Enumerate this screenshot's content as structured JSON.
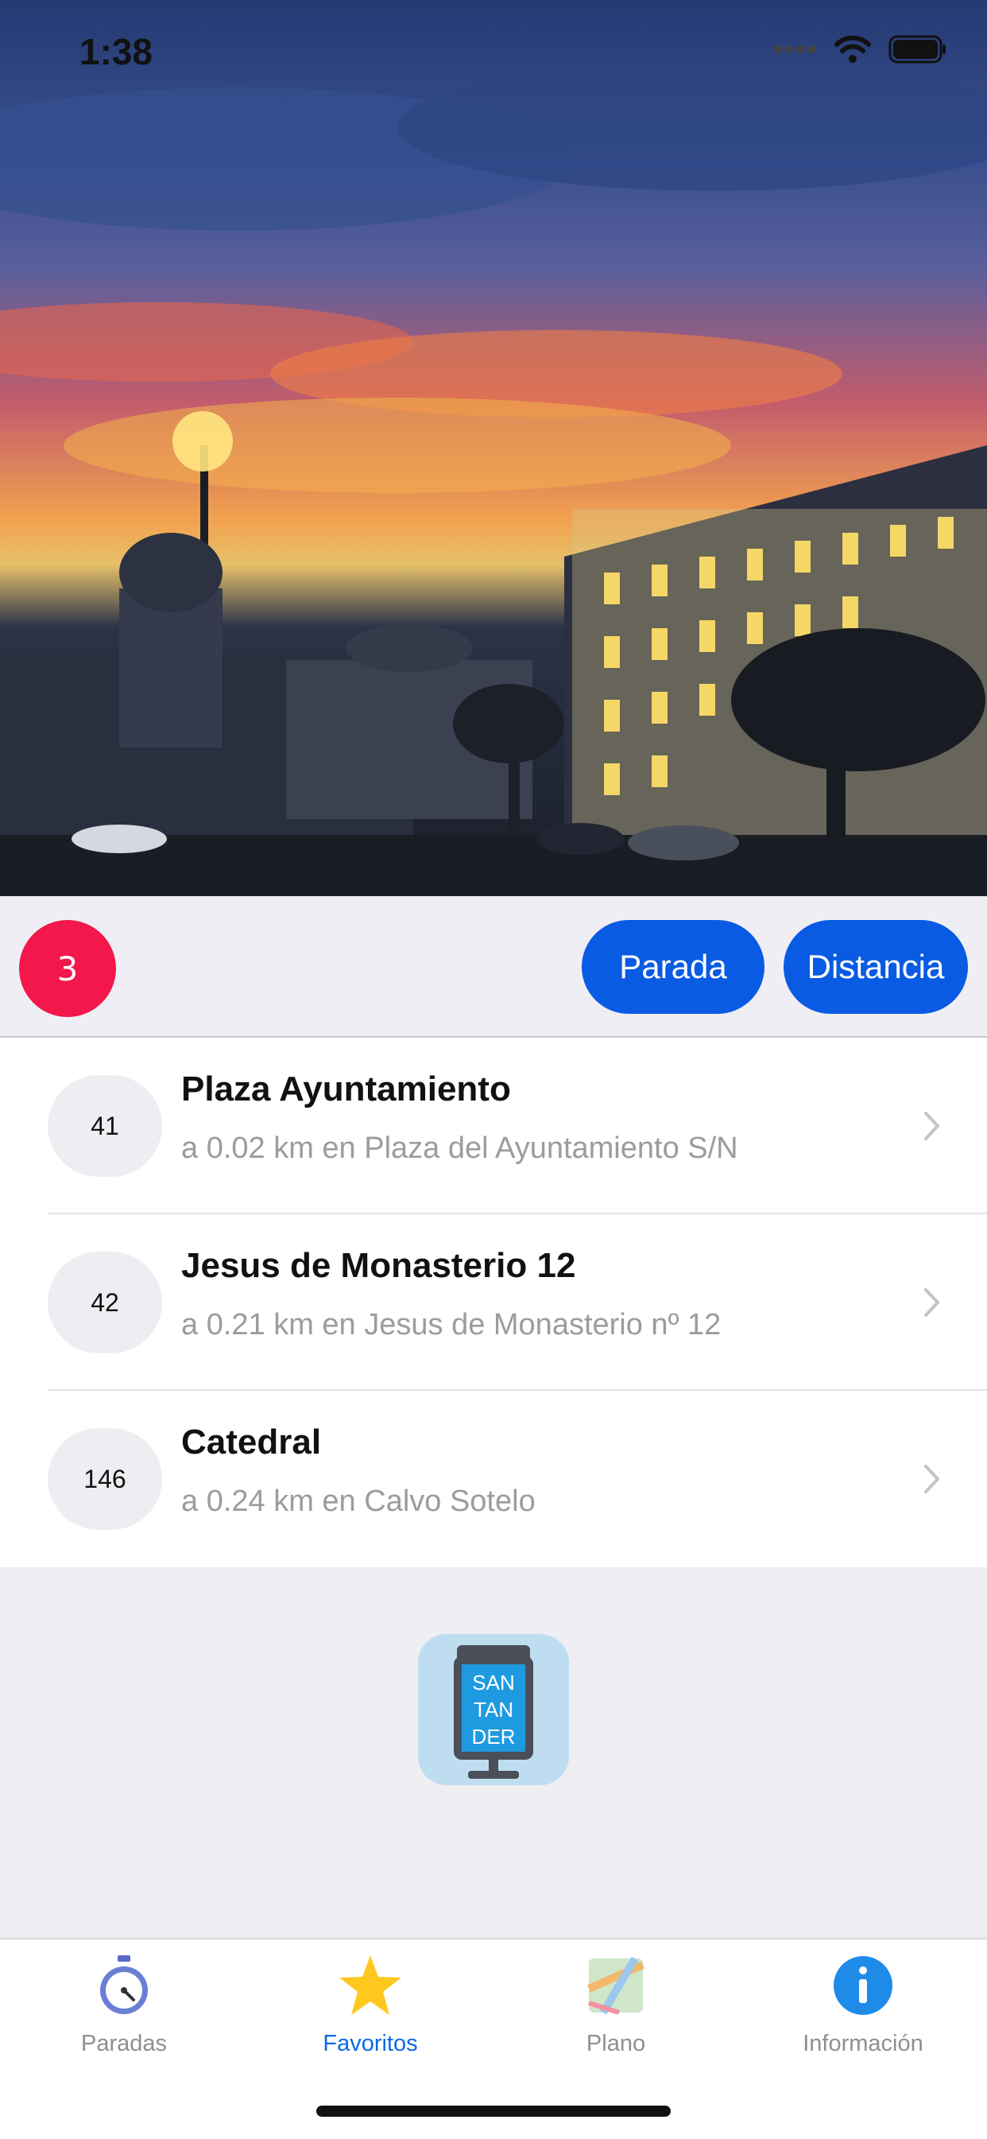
{
  "status": {
    "time": "1:38"
  },
  "filter": {
    "count": "3",
    "sort_stop": "Parada",
    "sort_distance": "Distancia"
  },
  "stops": [
    {
      "number": "41",
      "name": "Plaza Ayuntamiento",
      "detail": "a 0.02 km en Plaza del Ayuntamiento S/N"
    },
    {
      "number": "42",
      "name": "Jesus de Monasterio 12",
      "detail": "a 0.21 km en Jesus de Monasterio nº 12"
    },
    {
      "number": "146",
      "name": "Catedral",
      "detail": "a 0.24 km en Calvo Sotelo"
    }
  ],
  "logo": {
    "lines": [
      "SAN",
      "TAN",
      "DER"
    ]
  },
  "tabs": [
    {
      "label": "Paradas",
      "icon": "stopwatch-icon"
    },
    {
      "label": "Favoritos",
      "icon": "star-icon"
    },
    {
      "label": "Plano",
      "icon": "map-icon"
    },
    {
      "label": "Información",
      "icon": "info-icon"
    }
  ],
  "colors": {
    "accent": "#0A5BE3",
    "badge": "#F4174B",
    "active_tab": "#0A6BE8"
  }
}
